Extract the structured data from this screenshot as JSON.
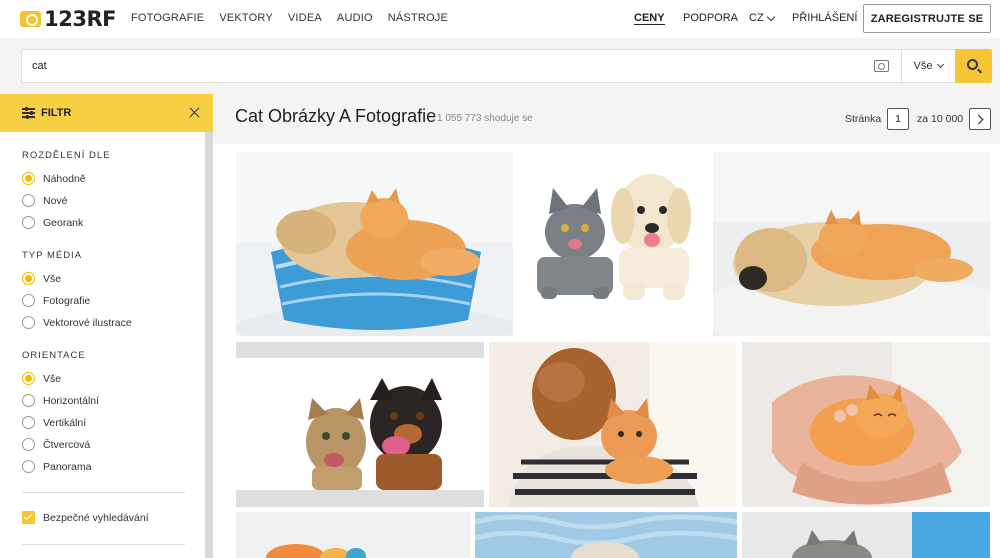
{
  "logo": {
    "text": "123RF"
  },
  "nav": {
    "left": [
      "FOTOGRAFIE",
      "VEKTORY",
      "VIDEA",
      "AUDIO",
      "NÁSTROJE"
    ],
    "pricing": "CENY",
    "support": "PODPORA",
    "language": "CZ",
    "login": "PŘIHLÁŠENÍ",
    "register": "ZAREGISTRUJTE SE"
  },
  "search": {
    "value": "cat",
    "type_selected": "Vše"
  },
  "sidebar": {
    "filter_label": "FILTR",
    "sort": {
      "title": "ROZDĚLENÍ DLE",
      "options": [
        "Náhodně",
        "Nové",
        "Georank"
      ],
      "selected": "Náhodně"
    },
    "media": {
      "title": "TYP MÉDIA",
      "options": [
        "Vše",
        "Fotografie",
        "Vektorové ilustrace"
      ],
      "selected": "Vše"
    },
    "orientation": {
      "title": "ORIENTACE",
      "options": [
        "Vše",
        "Horizontální",
        "Vertikální",
        "Čtvercová",
        "Panorama"
      ],
      "selected": "Vše"
    },
    "safe_search": {
      "label": "Bezpečné vyhledávání",
      "checked": true
    }
  },
  "results": {
    "title": "Cat Obrázky A Fotografie",
    "count": "1 055 773 shoduje se",
    "page_label": "Stránka",
    "page_current": "1",
    "page_of": "za 10 000"
  },
  "colors": {
    "accent": "#f5c538",
    "filter_bg": "#f7cf45",
    "radio_selected": "#f5b800"
  }
}
